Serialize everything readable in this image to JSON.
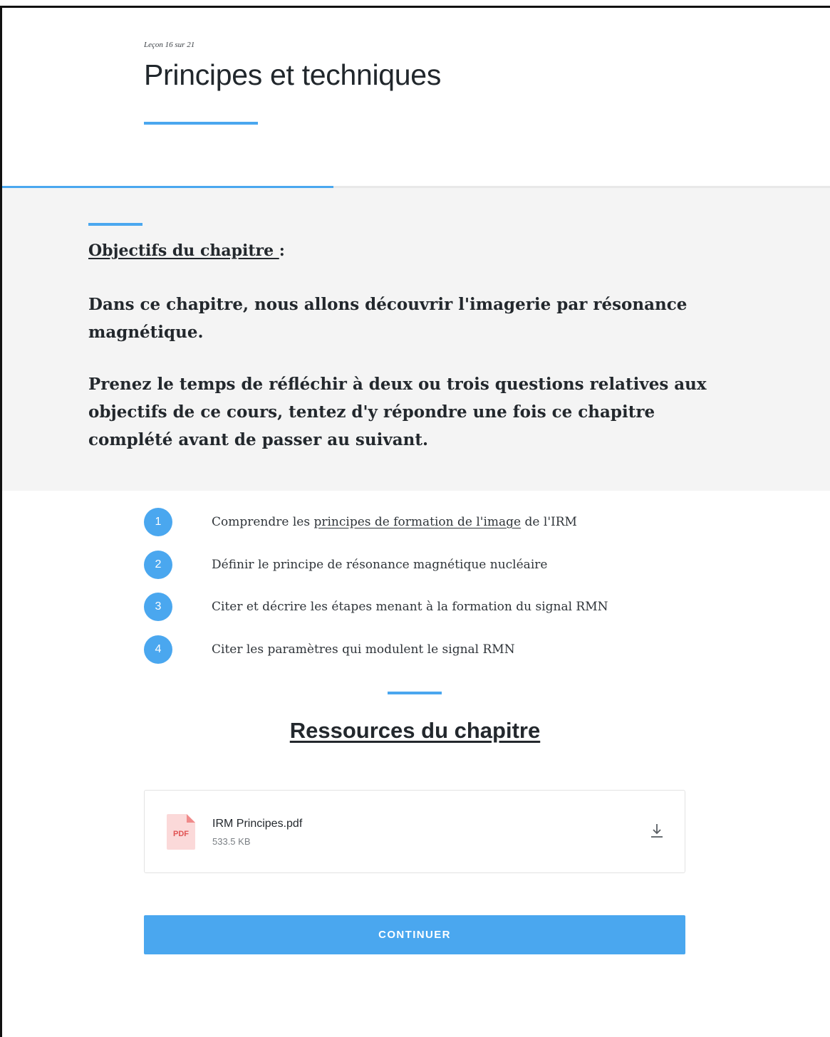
{
  "lesson": {
    "counter": "Leçon 16 sur 21",
    "title": "Principes et techniques",
    "progress": 0.4
  },
  "objectives": {
    "heading": "Objectifs du chapitre ",
    "heading_suffix": ":",
    "paragraph_1": "Dans ce chapitre, nous allons découvrir l'imagerie par résonance magnétique.",
    "paragraph_2": "Prenez le temps de réfléchir à deux ou trois questions relatives aux objectifs de ce cours, tentez d'y répondre une fois ce chapitre complété avant de passer au suivant."
  },
  "steps": [
    {
      "number": "1",
      "text_before": "Comprendre les ",
      "link": "principes de formation de l'image",
      "text_after": " de l'IRM"
    },
    {
      "number": "2",
      "text": "Définir le principe de résonance magnétique nucléaire"
    },
    {
      "number": "3",
      "text": "Citer et décrire les étapes menant à la formation du signal RMN"
    },
    {
      "number": "4",
      "text": "Citer les paramètres qui modulent le signal RMN"
    }
  ],
  "resources": {
    "heading": "Ressources du chapitre",
    "file": {
      "icon_label": "PDF",
      "name": "IRM Principes.pdf",
      "size": "533.5 KB",
      "download_icon": "download-icon"
    }
  },
  "continue_label": "CONTINUER",
  "colors": {
    "accent": "#4aa7ef",
    "section_bg": "#f4f4f4",
    "pdf_red": "#e05353",
    "pdf_bg": "#fbd9d9"
  }
}
